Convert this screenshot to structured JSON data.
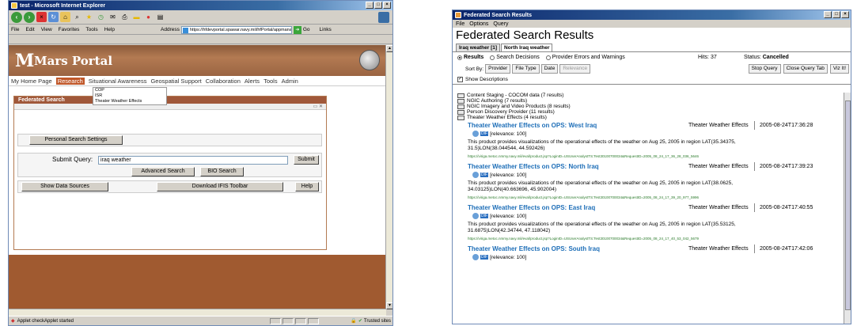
{
  "ie": {
    "title": "test - Microsoft Internet Explorer",
    "menu": [
      "File",
      "Edit",
      "View",
      "Favorites",
      "Tools",
      "Help"
    ],
    "address_label": "Address",
    "address_url": "https://hfdevportal.spawar.navy.mil/hfPortal/appmanager/...",
    "go_label": "Go",
    "links_label": "Links",
    "status_text": "Applet checkApplet started",
    "trusted_label": "Trusted sites"
  },
  "portal": {
    "title": "Mars Portal",
    "nav": [
      "My Home Page",
      "Research",
      "Situational Awareness",
      "Geospatial Support",
      "Collaboration",
      "Alerts",
      "Tools",
      "Admin"
    ],
    "active_nav": "Research",
    "dropdown": [
      "COP",
      "ISR",
      "Theater Weather Effects"
    ],
    "panel_title": "Federated Search",
    "personal_settings": "Personal Search Settings",
    "submit_query_label": "Submit Query:",
    "query_value": "iraq weather",
    "submit_label": "Submit",
    "advanced_search": "Advanced Search",
    "bio_search": "BIO Search",
    "show_data_sources": "Show Data Sources",
    "download_toolbar": "Download IFIS Toolbar",
    "help": "Help"
  },
  "fsr": {
    "title": "Federated Search Results",
    "menu": [
      "File",
      "Options",
      "Query"
    ],
    "heading": "Federated Search Results",
    "tabs": [
      "Iraq weather [1]",
      "North Iraq weather"
    ],
    "radios": [
      "Results",
      "Search Decisions",
      "Provider Errors and Warnings"
    ],
    "hits_label": "Hits: 37",
    "status_label": "Status:",
    "status_value": "Cancelled",
    "sort_by": "Sort By:",
    "sort_buttons": [
      "Provider",
      "File Type",
      "Date",
      "Relevance"
    ],
    "right_buttons": [
      "Stop Query",
      "Close Query Tab",
      "Viz It!"
    ],
    "show_descriptions": "Show Descriptions",
    "folders": [
      "Content Staging - COCOM data (7 results)",
      "NGIC Authoring (7 results)",
      "NGIC Imagery and Video Products (8 results)",
      "Person Discovery Provider (11 results)",
      "Theater Weather Effects (4 results)"
    ],
    "results": [
      {
        "title": "Theater Weather Effects on OPS: West Iraq",
        "source": "Theater Weather Effects",
        "date": "2005-08-24T17:36:28",
        "dif": "DIF",
        "relevance": "[relevance: 100]",
        "desc": "This product provides visualizations of the operational effects of the weather on Aug 25, 2005 in region LAT(35.34375, 31.5)LON(38.044544, 44.592426)",
        "url": "https://viriga.metoc.nmmy.navy.mil/eval/product.jsp?LoginID=USUserAnalystTS:Test30100700034&RequestID=2005_08_24_17_36_28_036_5646"
      },
      {
        "title": "Theater Weather Effects on OPS: North Iraq",
        "source": "Theater Weather Effects",
        "date": "2005-08-24T17:39:23",
        "dif": "DIF",
        "relevance": "[relevance: 100]",
        "desc": "This product provides visualizations of the operational effects of the weather on Aug 25, 2005 in region LAT(38.0625, 34.03125)LON(40.663696, 45.902004)",
        "url": "https://viriga.metoc.nmmy.navy.mil/eval/product.jsp?LoginID=USUserAnalystTS:Test30100700034&RequestID=2005_08_24_17_39_20_977_5996"
      },
      {
        "title": "Theater Weather Effects on OPS: East Iraq",
        "source": "Theater Weather Effects",
        "date": "2005-08-24T17:40:55",
        "dif": "DIF",
        "relevance": "[relevance: 100]",
        "desc": "This product provides visualizations of the operational effects of the weather on Aug 25, 2005 in region LAT(35.53125, 31.6875)LON(42.34744, 47.118042)",
        "url": "https://viriga.metoc.nmmy.navy.mil/eval/product.jsp?LoginID=USUserAnalystTS:Test30100700034&RequestID=2005_08_24_17_40_53_042_5679"
      },
      {
        "title": "Theater Weather Effects on OPS: South Iraq",
        "source": "Theater Weather Effects",
        "date": "2005-08-24T17:42:06",
        "dif": "DIF",
        "relevance": "[relevance: 100]",
        "desc": "",
        "url": ""
      }
    ]
  }
}
